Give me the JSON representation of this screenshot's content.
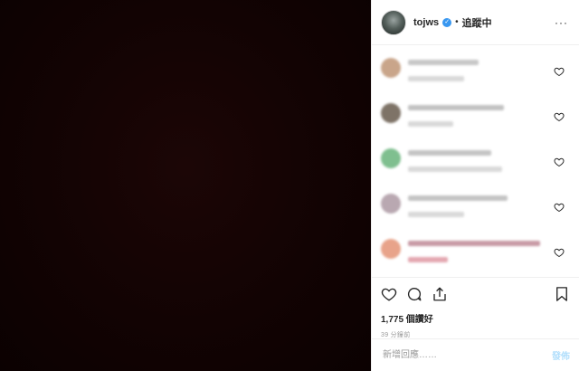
{
  "header": {
    "username": "tojws",
    "separator": "•",
    "follow_label": "追蹤中",
    "more_label": "···"
  },
  "comments": [
    {
      "avatar_color": "#c9a58a",
      "line1_color": "#c7c7c7",
      "line2_color": "#d9d9d9",
      "line1_w": 78,
      "line2_w": 62
    },
    {
      "avatar_color": "#7e7367",
      "line1_color": "#c2c2c2",
      "line2_color": "#d9d9d9",
      "line1_w": 106,
      "line2_w": 50
    },
    {
      "avatar_color": "#7fbf8f",
      "line1_color": "#c4c4c4",
      "line2_color": "#d9d9d9",
      "line1_w": 92,
      "line2_w": 104
    },
    {
      "avatar_color": "#b9a8b1",
      "line1_color": "#c4c4c4",
      "line2_color": "#d9d9d9",
      "line1_w": 110,
      "line2_w": 62
    },
    {
      "avatar_color": "#e8a38a",
      "line1_color": "#c89aa5",
      "line2_color": "#e4a7b0",
      "line1_w": 146,
      "line2_w": 44
    }
  ],
  "likes_text": "1,775 個讚好",
  "time_text": "39 分鐘前",
  "add_comment": {
    "placeholder": "新增回應……",
    "post_label": "發佈"
  },
  "colors": {
    "verified": "#3897f0",
    "post_disabled": "#b2dffc"
  }
}
